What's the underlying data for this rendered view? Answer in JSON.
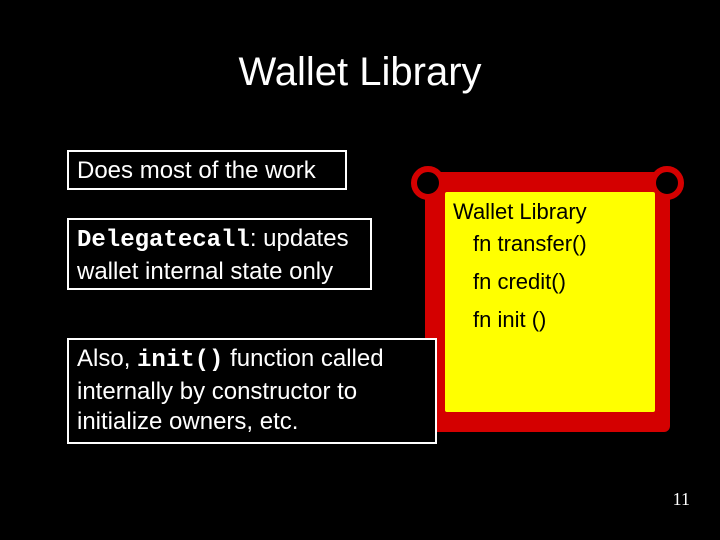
{
  "title": "Wallet Library",
  "box1": "Does most of the work",
  "box2": {
    "mono1": "Delegatecall",
    "rest1": ": updates",
    "line2": "wallet internal state only"
  },
  "box3": {
    "pre1": "Also, ",
    "mono1": "init()",
    "post1": "  function called",
    "line2": "internally by constructor to",
    "line3": "initialize owners, etc."
  },
  "contract": {
    "header": "Wallet Library",
    "fn1": "fn transfer()",
    "fn2": "fn credit()",
    "fn3": "fn init ()"
  },
  "page_number": "11"
}
